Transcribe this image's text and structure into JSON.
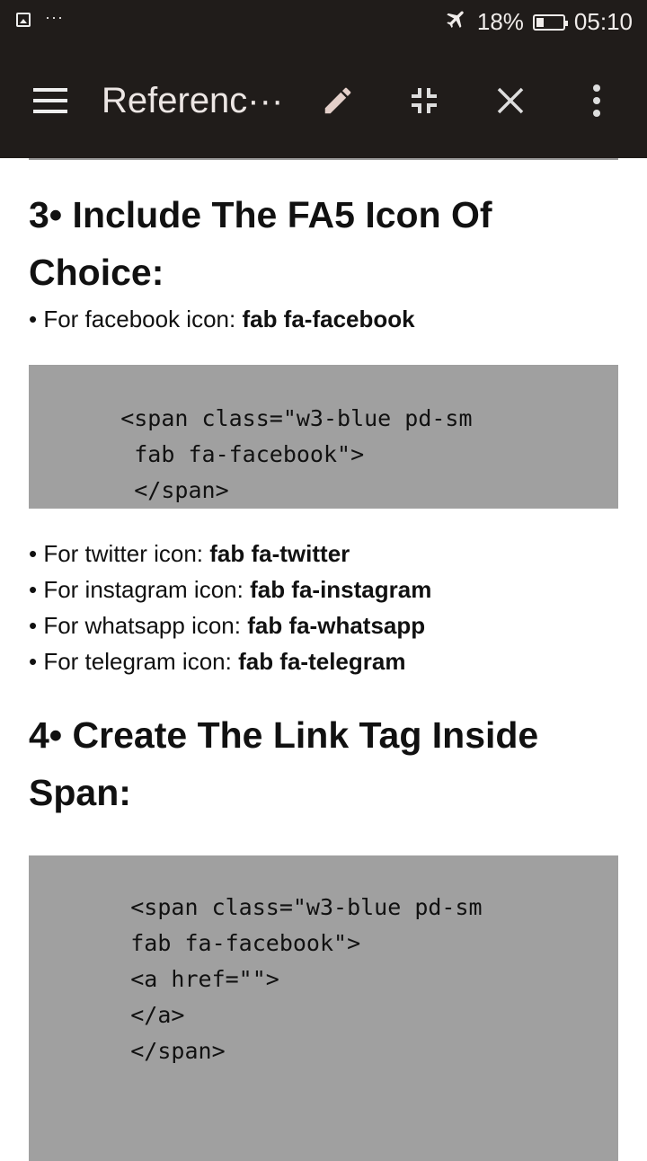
{
  "status_bar": {
    "more": "···",
    "battery": "18%",
    "time": "05:10"
  },
  "toolbar": {
    "title": "Referenc···"
  },
  "section3": {
    "heading_line1": "3• Include The FA5 Icon Of",
    "heading_line2": "Choice:",
    "facebook_label": "• For facebook icon: ",
    "facebook_class": "fab fa-facebook",
    "code_lines": [
      "    <span class=\"w3-blue pd-sm",
      "     fab fa-facebook\">",
      "     </span>"
    ],
    "bullets": [
      {
        "label": "• For twitter icon: ",
        "value": "fab fa-twitter"
      },
      {
        "label": "• For instagram icon: ",
        "value": "fab fa-instagram"
      },
      {
        "label": "• For whatsapp icon: ",
        "value": "fab fa-whatsapp"
      },
      {
        "label": "• For telegram icon: ",
        "value": "fab fa-telegram"
      }
    ]
  },
  "section4": {
    "heading_line1": "4• Create The Link Tag Inside",
    "heading_line2": "Span:",
    "code_lines": [
      "     <span class=\"w3-blue pd-sm",
      "     fab fa-facebook\">",
      "",
      "     <a href=\"\">",
      "     </a>",
      "",
      "     </span>"
    ]
  }
}
